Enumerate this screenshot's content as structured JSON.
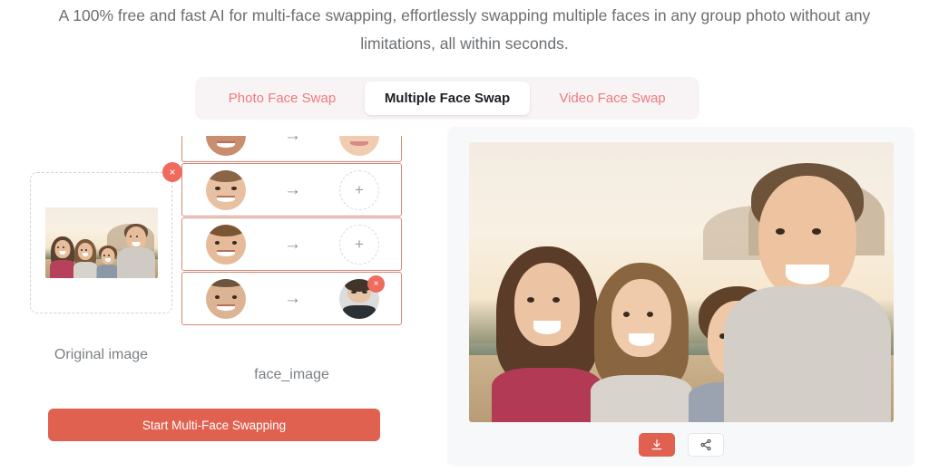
{
  "intro": {
    "text": "A 100% free and fast AI for multi-face swapping, effortlessly swapping multiple faces in any group photo without any limitations, all within seconds."
  },
  "tabs": [
    {
      "label": "Photo Face Swap",
      "active": false
    },
    {
      "label": "Multiple Face Swap",
      "active": true
    },
    {
      "label": "Video Face Swap",
      "active": false
    }
  ],
  "colors": {
    "accent": "#e0614f",
    "tab_inactive_text": "#ef7a80",
    "tab_bar_bg": "#f8f4f5",
    "row_border": "#d98878",
    "card_bg": "#f7f8f9",
    "badge": "#ef6b5e"
  },
  "upload": {
    "caption": "Original image",
    "remove_label": "×",
    "alt": "Family group photo: woman, girl, boy and man outdoors at sunset"
  },
  "face_list": {
    "caption": "face_image",
    "arrow_glyph": "→",
    "add_glyph": "+",
    "remove_label": "×",
    "rows": [
      {
        "source_alt": "Detected face 1 — woman",
        "target_alt": "Blonde woman portrait",
        "target_filled": true
      },
      {
        "source_alt": "Detected face 2 — girl",
        "target_alt": "",
        "target_filled": false
      },
      {
        "source_alt": "Detected face 3 — boy",
        "target_alt": "",
        "target_filled": false
      },
      {
        "source_alt": "Detected face 4 — man",
        "target_alt": "Man in suit portrait",
        "target_filled": true
      }
    ]
  },
  "cta": {
    "label": "Start Multi-Face Swapping"
  },
  "result": {
    "alt": "Swapped result: family group photo with replaced faces at sunset",
    "download_label": "download-icon",
    "share_label": "share-icon"
  }
}
